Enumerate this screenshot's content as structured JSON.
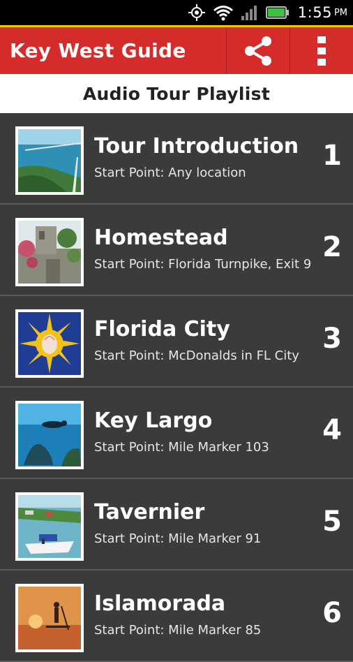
{
  "status_bar": {
    "time": "1:55",
    "ampm": "PM",
    "icons": [
      "gps-icon",
      "wifi-icon",
      "signal-icon",
      "battery-icon"
    ]
  },
  "action_bar": {
    "title": "Key West Guide",
    "actions": [
      "share-icon",
      "overflow-menu-icon"
    ],
    "colors": {
      "background": "#d42b2b",
      "accent_stripe": "#f2c200"
    }
  },
  "subtitle": "Audio Tour Playlist",
  "tours": [
    {
      "title": "Tour Introduction",
      "start": "Start Point: Any location",
      "number": "1",
      "thumb": "bridge-aerial-image"
    },
    {
      "title": "Homestead",
      "start": "Start Point: Florida Turnpike, Exit 9",
      "number": "2",
      "thumb": "coral-castle-image"
    },
    {
      "title": "Florida City",
      "start": "Start Point: McDonalds in FL City",
      "number": "3",
      "thumb": "sun-shell-logo-image"
    },
    {
      "title": "Key Largo",
      "start": "Start Point: Mile Marker 103",
      "number": "4",
      "thumb": "diver-underwater-image"
    },
    {
      "title": "Tavernier",
      "start": "Start Point: Mile Marker 91",
      "number": "5",
      "thumb": "boat-marina-image"
    },
    {
      "title": "Islamorada",
      "start": "Start Point: Mile Marker 85",
      "number": "6",
      "thumb": "sunset-paddleboard-image"
    }
  ]
}
